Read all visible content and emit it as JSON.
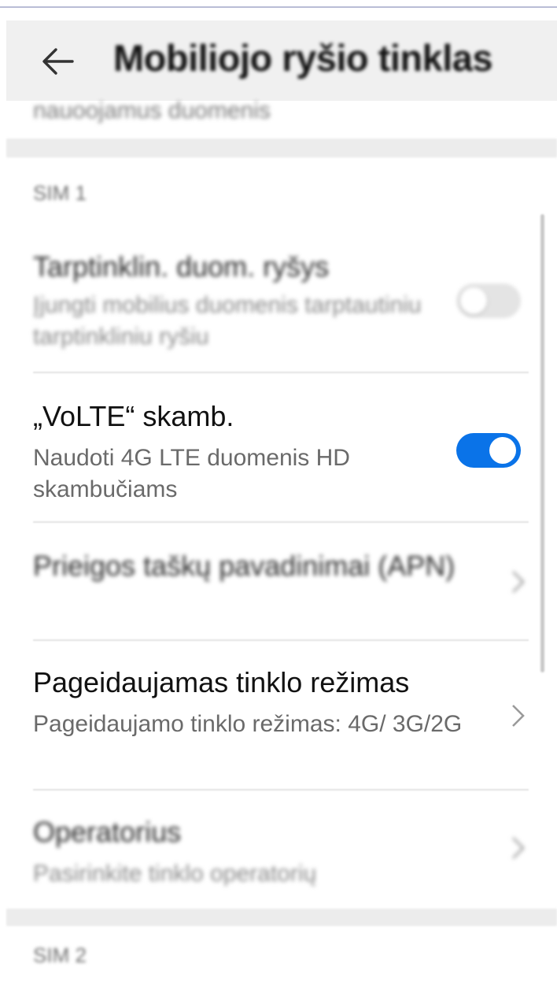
{
  "header": {
    "title": "Mobiliojo ryšio tinklas",
    "back_icon": "arrow-left-icon"
  },
  "previous_item_subtitle_cut": "nauoojamus duomenis",
  "sections": [
    {
      "label": "SIM 1",
      "items": [
        {
          "title": "Tarptinklin. duom. ryšys",
          "subtitle": "Įjungti mobilius duomenis tarptautiniu tarptinkliniu ryšiu",
          "control": "toggle",
          "state": "off"
        },
        {
          "title": "„VoLTE“ skamb.",
          "subtitle": "Naudoti 4G LTE duomenis HD skambučiams",
          "control": "toggle",
          "state": "on"
        },
        {
          "title": "Prieigos taškų pavadinimai (APN)",
          "control": "chevron"
        },
        {
          "title": "Pageidaujamas tinklo režimas",
          "subtitle": "Pageidaujamo tinklo režimas: 4G/ 3G/2G",
          "control": "chevron"
        },
        {
          "title": "Operatorius",
          "subtitle": "Pasirinkite tinklo operatorių",
          "control": "chevron"
        }
      ]
    },
    {
      "label": "SIM 2",
      "items": []
    }
  ],
  "colors": {
    "accent": "#0a73e8",
    "header_bg": "#f0f0f0",
    "divider": "#e2e2e2",
    "subtitle": "#6a6a6a"
  }
}
